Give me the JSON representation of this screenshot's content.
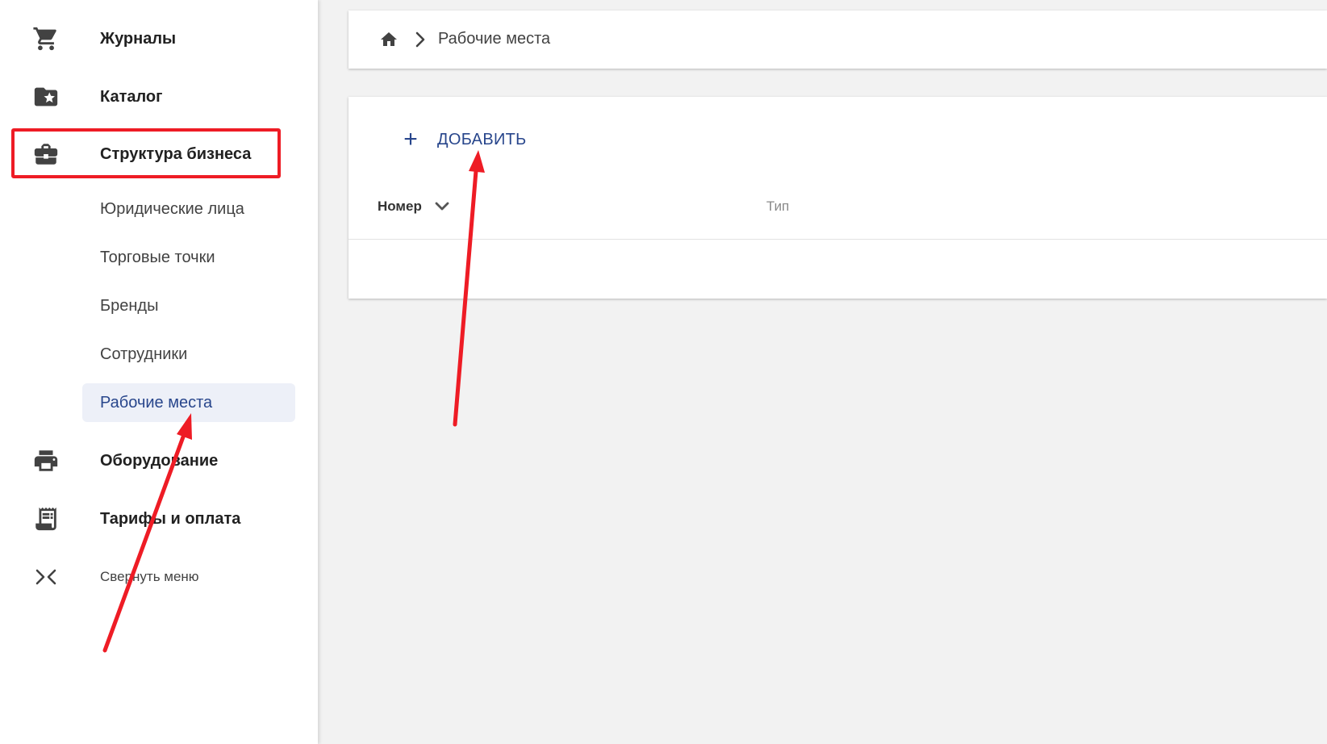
{
  "sidebar": {
    "items": [
      {
        "label": "Журналы",
        "icon": "cart-icon"
      },
      {
        "label": "Каталог",
        "icon": "folder-star-icon"
      },
      {
        "label": "Структура бизнеса",
        "icon": "briefcase-icon"
      }
    ],
    "subitems": [
      {
        "label": "Юридические лица"
      },
      {
        "label": "Торговые точки"
      },
      {
        "label": "Бренды"
      },
      {
        "label": "Сотрудники"
      },
      {
        "label": "Рабочие места",
        "active": true
      }
    ],
    "items_after": [
      {
        "label": "Оборудование",
        "icon": "printer-icon"
      },
      {
        "label": "Тарифы и оплата",
        "icon": "receipt-icon"
      }
    ],
    "collapse_label": "Свернуть меню"
  },
  "breadcrumb": {
    "current": "Рабочие места"
  },
  "table": {
    "add_label": "ДОБАВИТЬ",
    "columns": [
      "Номер",
      "Тип"
    ]
  },
  "colors": {
    "accent": "#28468c",
    "active_bg": "#edf0f8",
    "annotation": "#ee1c25"
  }
}
